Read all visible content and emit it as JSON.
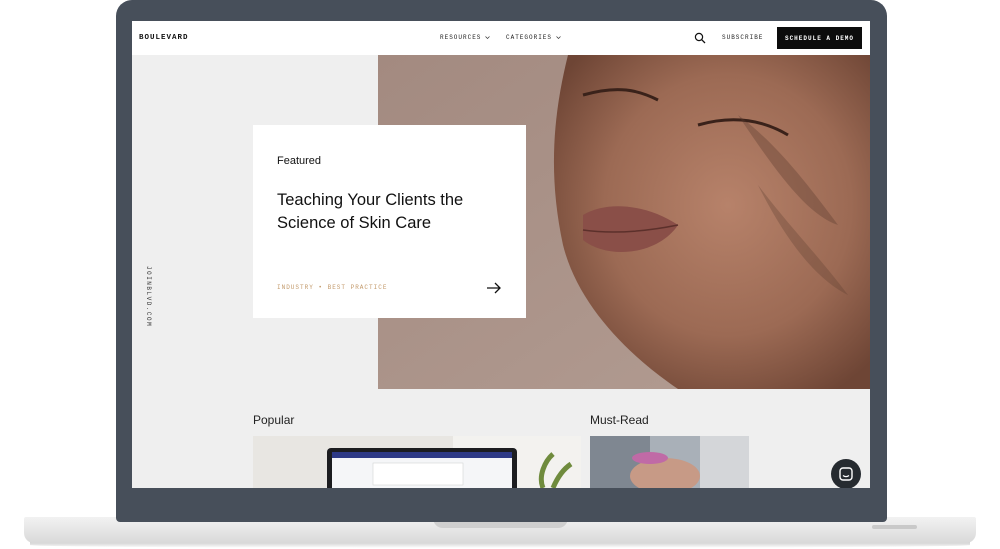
{
  "nav": {
    "logo": "BOULEVARD",
    "resources": "RESOURCES",
    "categories": "CATEGORIES",
    "subscribe": "SUBSCRIBE",
    "cta": "SCHEDULE A DEMO"
  },
  "side_url": "JOINBLVD.COM",
  "featured": {
    "label": "Featured",
    "title": "Teaching Your Clients the Science of Skin Care",
    "tags": "INDUSTRY • BEST PRACTICE"
  },
  "sections": {
    "popular": "Popular",
    "must_read": "Must-Read"
  },
  "icons": [
    "search-icon",
    "chevron-down-icon",
    "arrow-right-icon",
    "chat-icon"
  ],
  "colors": {
    "bezel": "#474f5a",
    "cta_bg": "#0c0c0c",
    "tag_color": "#c39a6b",
    "page_bg": "#efefef"
  }
}
